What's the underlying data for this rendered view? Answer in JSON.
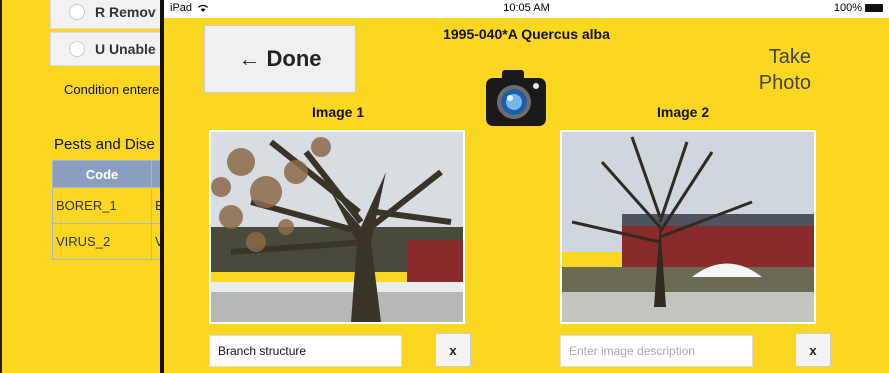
{
  "background": {
    "radio_options": [
      {
        "label": "R Remov"
      },
      {
        "label": "U Unable"
      }
    ],
    "condition_text": "Condition entere",
    "pests_title": "Pests and Dise",
    "table_header": "Code",
    "table_rows": [
      {
        "code": "BORER_1",
        "desc": "Bo"
      },
      {
        "code": "VIRUS_2",
        "desc": "Vi"
      }
    ]
  },
  "status_bar": {
    "device": "iPad",
    "time": "10:05 AM",
    "battery": "100%"
  },
  "header": {
    "title": "1995-040*A Quercus alba",
    "done_label": "Done",
    "done_arrow": "←",
    "take_photo_label": "Take Photo"
  },
  "images": [
    {
      "title": "Image 1",
      "description": "Branch structure",
      "placeholder": "Enter image description",
      "remove_label": "x"
    },
    {
      "title": "Image 2",
      "description": "",
      "placeholder": "Enter image description",
      "remove_label": "x"
    }
  ],
  "colors": {
    "background": "#fcd722",
    "table_header": "#8a9fc0",
    "barn_red": "#8a2a2a"
  },
  "icons": [
    "wifi-icon",
    "battery-icon",
    "camera-icon"
  ]
}
